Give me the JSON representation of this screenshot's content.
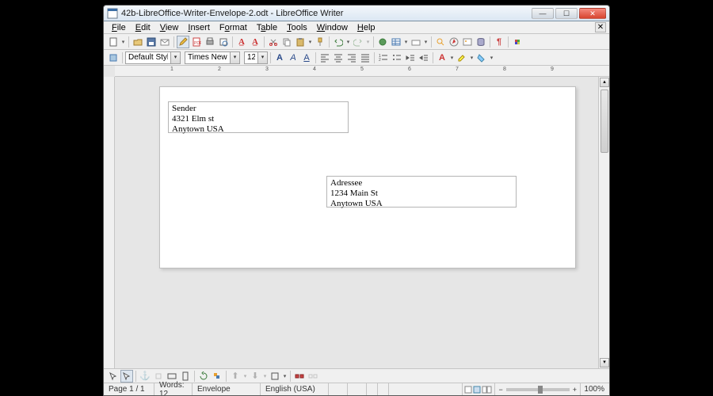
{
  "window": {
    "title": "42b-LibreOffice-Writer-Envelope-2.odt - LibreOffice Writer"
  },
  "menu": {
    "file": "File",
    "edit": "Edit",
    "view": "View",
    "insert": "Insert",
    "format": "Format",
    "table": "Table",
    "tools": "Tools",
    "window": "Window",
    "help": "Help"
  },
  "formatting": {
    "para_style": "Default Style",
    "font_name": "Times New Roman",
    "font_size": "12"
  },
  "ruler": {
    "h_nums": [
      "1",
      "2",
      "3",
      "4",
      "5",
      "6",
      "7",
      "8",
      "9"
    ]
  },
  "envelope": {
    "sender": {
      "line1": "Sender",
      "line2": "4321 Elm st",
      "line3": "Anytown USA"
    },
    "addressee": {
      "line1": "Adressee",
      "line2": "1234 Main St",
      "line3": "Anytown USA"
    }
  },
  "status": {
    "page": "Page 1 / 1",
    "words": "Words: 12",
    "page_style": "Envelope",
    "language": "English (USA)",
    "zoom": "100%"
  }
}
